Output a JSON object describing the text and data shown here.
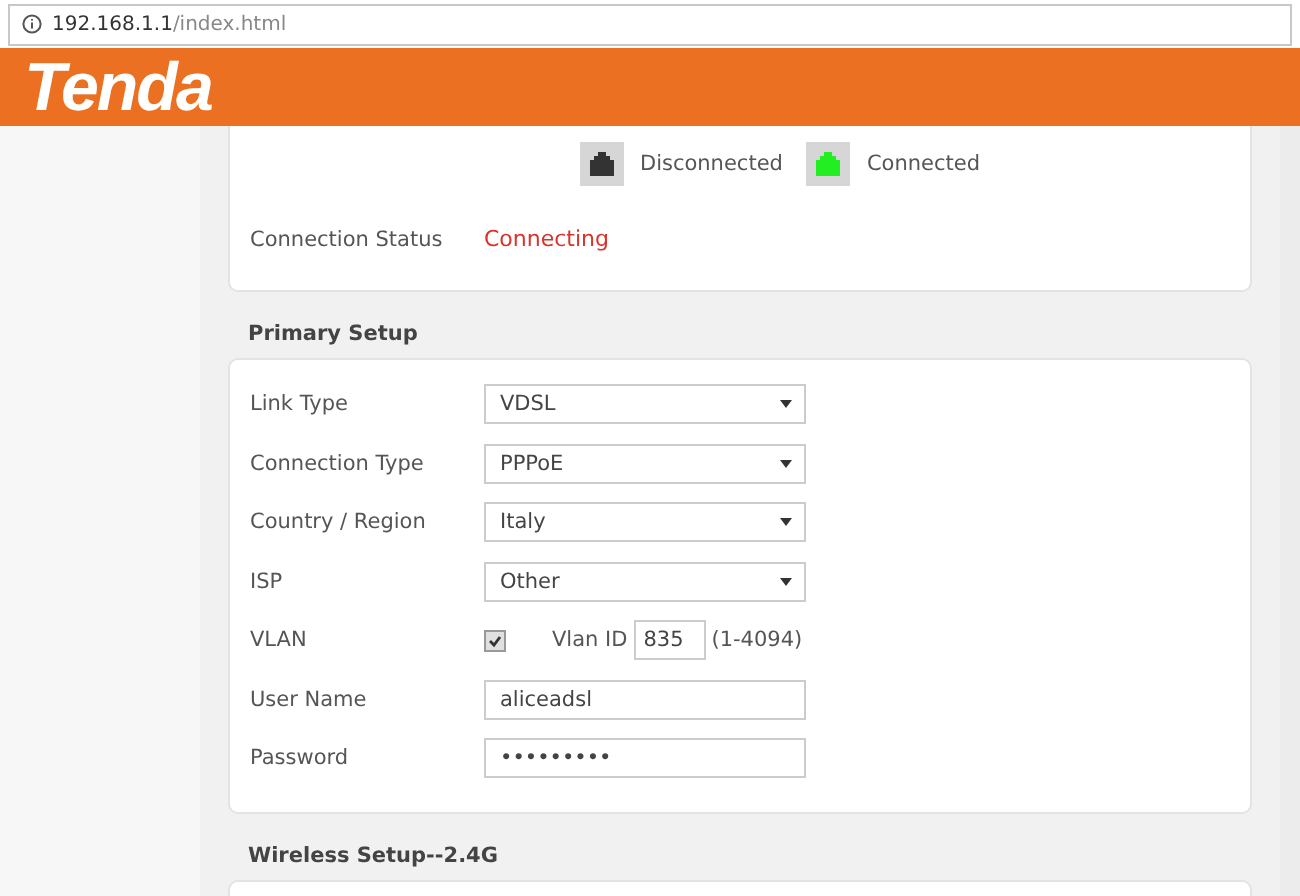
{
  "address_bar": {
    "host": "192.168.1.1",
    "path": "/index.html"
  },
  "header": {
    "logo": "Tenda"
  },
  "status_card": {
    "legend": [
      {
        "label": "Disconnected",
        "color": "#333333"
      },
      {
        "label": "Connected",
        "color": "#22ee22"
      }
    ],
    "status": {
      "label": "Connection Status",
      "value": "Connecting"
    }
  },
  "primary_setup": {
    "title": "Primary Setup",
    "fields": [
      {
        "kind": "select",
        "label": "Link Type",
        "value": "VDSL"
      },
      {
        "kind": "select",
        "label": "Connection Type",
        "value": "PPPoE"
      },
      {
        "kind": "select",
        "label": "Country / Region",
        "value": "Italy"
      },
      {
        "kind": "select",
        "label": "ISP",
        "value": "Other"
      },
      {
        "kind": "vlan",
        "label": "VLAN",
        "checked": true,
        "id_label": "Vlan ID",
        "value": "835",
        "range": "(1-4094)"
      },
      {
        "kind": "text",
        "label": "User Name",
        "value": "aliceadsl"
      },
      {
        "kind": "text",
        "label": "Password",
        "value": "•••••••••"
      }
    ]
  },
  "wireless_setup": {
    "title": "Wireless Setup--2.4G"
  }
}
